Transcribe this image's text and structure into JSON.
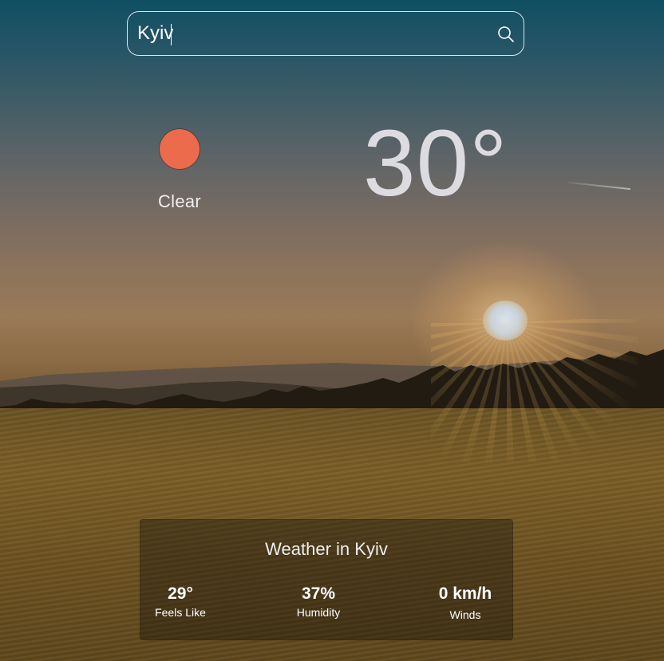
{
  "search": {
    "value": "Kyiv",
    "icon": "search-icon"
  },
  "current": {
    "condition": "Clear",
    "condition_icon": "sun-icon",
    "condition_color": "#ec6b4c",
    "temperature": "30°"
  },
  "details": {
    "title": "Weather in Kyiv",
    "stats": [
      {
        "value": "29°",
        "label": "Feels Like"
      },
      {
        "value": "37%",
        "label": "Humidity"
      },
      {
        "value": "0 km/h",
        "label": "Winds"
      }
    ]
  }
}
